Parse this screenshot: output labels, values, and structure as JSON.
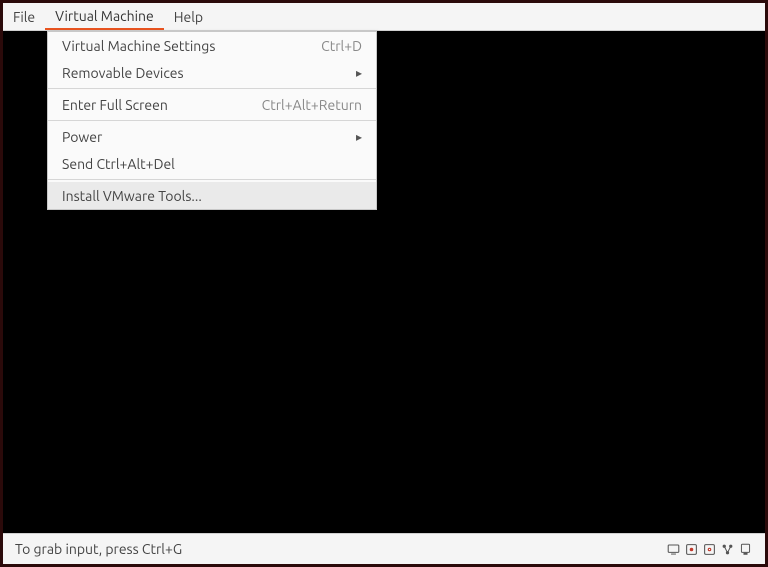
{
  "menubar": {
    "file": "File",
    "vm": "Virtual Machine",
    "help": "Help"
  },
  "menu": {
    "settings": {
      "label": "Virtual Machine Settings",
      "accel": "Ctrl+D"
    },
    "removable": {
      "label": "Removable Devices"
    },
    "fullscreen": {
      "label": "Enter Full Screen",
      "accel": "Ctrl+Alt+Return"
    },
    "power": {
      "label": "Power"
    },
    "sendcad": {
      "label": "Send Ctrl+Alt+Del"
    },
    "installtools": {
      "label": "Install VMware Tools..."
    }
  },
  "statusbar": {
    "text": "To grab input, press Ctrl+G"
  }
}
